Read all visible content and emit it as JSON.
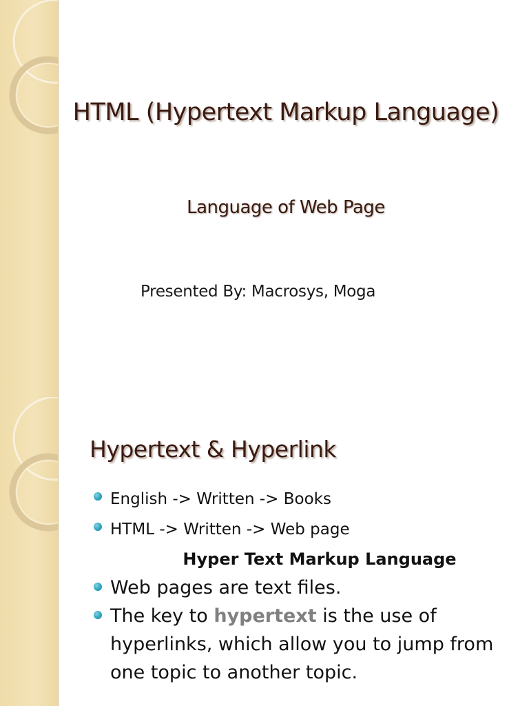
{
  "slide1": {
    "title": "HTML (Hypertext Markup Language)",
    "subtitle": "Language of Web Page",
    "presenter": "Presented By: Macrosys, Moga"
  },
  "slide2": {
    "title": "Hypertext & Hyperlink",
    "bullets": [
      "English -> Written -> Books",
      "HTML -> Written -> Web page"
    ],
    "expansion": "Hyper Text Markup Language",
    "bullet3": "Web pages are text files.",
    "bullet4_pre": "The key to ",
    "bullet4_highlight": "hypertext",
    "bullet4_post": " is the use of hyperlinks, which allow you to jump from one topic to another topic."
  },
  "colors": {
    "sidebar": "#efdcaa",
    "title": "#3b1a10",
    "bullet": "#2ba1b8",
    "highlight": "#808080"
  }
}
